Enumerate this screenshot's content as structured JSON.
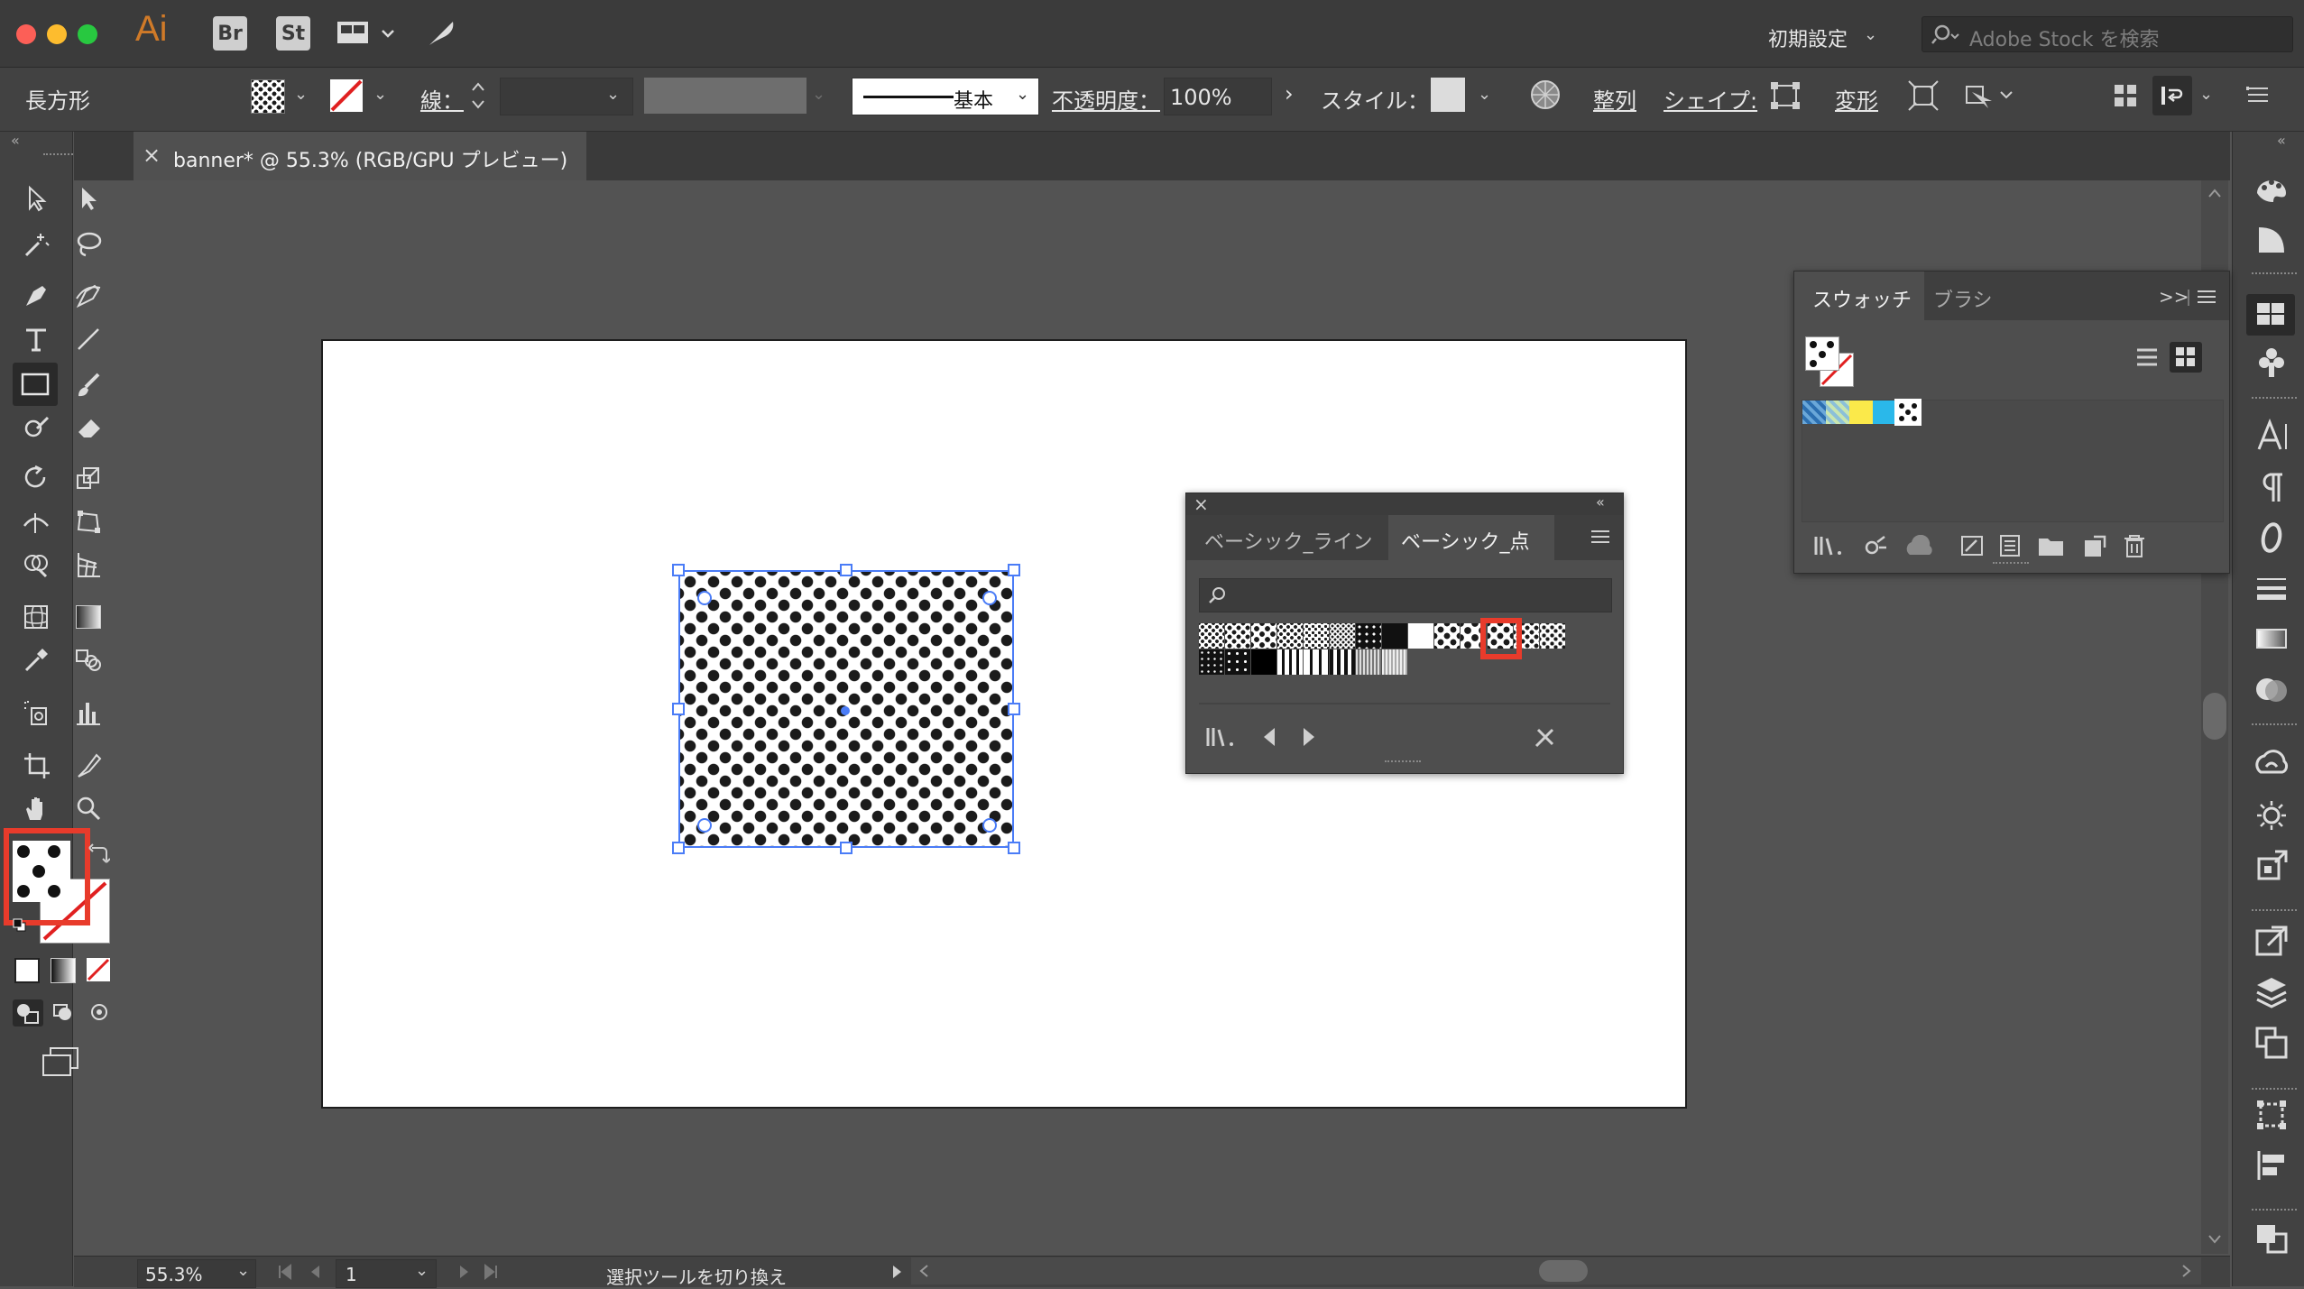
{
  "titlebar": {
    "app_logo": "Ai",
    "bridge": "Br",
    "stock": "St",
    "workspace": "初期設定",
    "search_placeholder": "Adobe Stock を検索"
  },
  "controlbar": {
    "object_type": "長方形",
    "stroke_label": "線：",
    "stroke_style": "基本",
    "opacity_label": "不透明度：",
    "opacity_value": "100%",
    "style_label": "スタイル：",
    "align": "整列",
    "shape": "シェイプ:",
    "transform": "変形"
  },
  "document": {
    "tab_title": "banner* @ 55.3% (RGB/GPU プレビュー)"
  },
  "swatch_library": {
    "tabs": [
      "ベーシック_ライン",
      "ベーシック_点"
    ],
    "active_tab": 1
  },
  "swatches_panel": {
    "tabs": [
      "スウォッチ",
      "ブラシ"
    ],
    "expand": ">>"
  },
  "statusbar": {
    "zoom": "55.3%",
    "artboard_number": "1",
    "status_text": "選択ツールを切り換え"
  },
  "colors": {
    "accent": "#4a7cf7",
    "highlight": "#e83b2b",
    "ai_orange": "#ff9a00"
  }
}
